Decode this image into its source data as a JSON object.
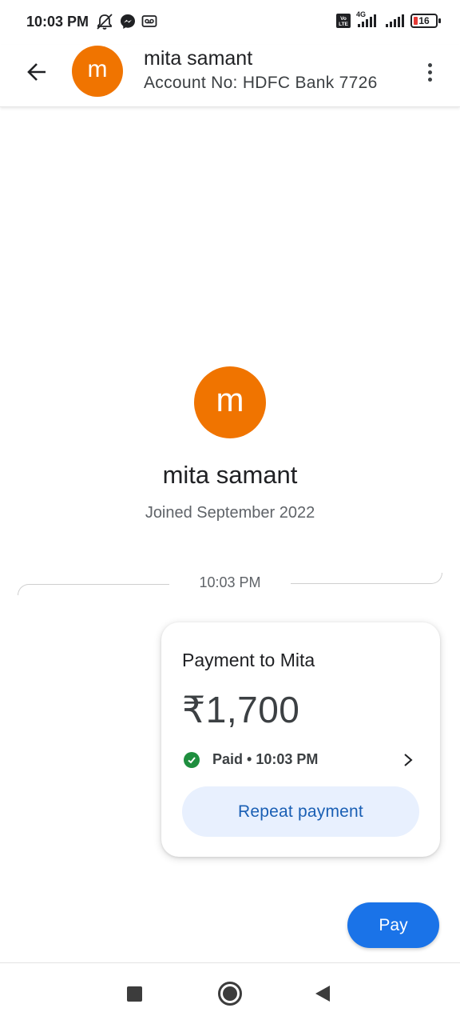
{
  "status_bar": {
    "time": "10:03 PM",
    "battery_level": "16",
    "network_label": "4G",
    "volte_label": "Vo LTE",
    "icons": [
      "mute-icon",
      "messenger-icon",
      "voicemail-icon",
      "volte-icon",
      "signal-icon",
      "signal-icon",
      "battery-icon"
    ]
  },
  "header": {
    "avatar_letter": "m",
    "title": "mita samant",
    "subtitle": "Account No: HDFC Bank 7726"
  },
  "profile": {
    "avatar_letter": "m",
    "name": "mita samant",
    "joined": "Joined September 2022"
  },
  "conversation": {
    "timestamp": "10:03 PM",
    "payment_card": {
      "title": "Payment to Mita",
      "amount": "₹1,700",
      "status": "Paid • 10:03 PM",
      "repeat_label": "Repeat payment"
    }
  },
  "actions": {
    "pay_label": "Pay"
  },
  "colors": {
    "avatar": "#f07400",
    "primary": "#1a73e8",
    "success": "#1e8e3e",
    "repeat_bg": "#e8f0fe",
    "repeat_text": "#1a5fb4",
    "battery_low": "#e53935"
  }
}
